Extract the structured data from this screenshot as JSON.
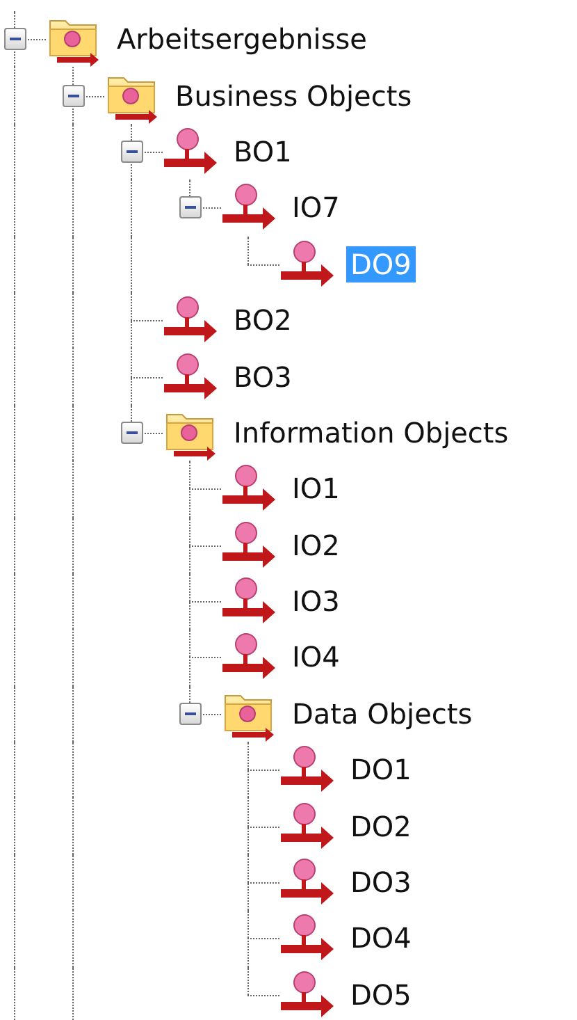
{
  "tree": {
    "items": [
      {
        "label": "Arbeitsergebnisse",
        "kind": "folder",
        "expanded": true,
        "selected": false,
        "more_above": true,
        "more_below": true,
        "children": [
          {
            "label": "Business Objects",
            "kind": "folder",
            "expanded": true,
            "selected": false,
            "more_below": true,
            "children": [
              {
                "label": "BO1",
                "kind": "object",
                "expanded": true,
                "selected": false,
                "children": [
                  {
                    "label": "IO7",
                    "kind": "object",
                    "expanded": true,
                    "selected": false,
                    "children": [
                      {
                        "label": "DO9",
                        "kind": "object",
                        "selected": true
                      }
                    ]
                  }
                ]
              },
              {
                "label": "BO2",
                "kind": "object",
                "selected": false
              },
              {
                "label": "BO3",
                "kind": "object",
                "selected": false
              },
              {
                "label": "Information Objects",
                "kind": "folder",
                "expanded": true,
                "selected": false,
                "children": [
                  {
                    "label": "IO1",
                    "kind": "object",
                    "selected": false
                  },
                  {
                    "label": "IO2",
                    "kind": "object",
                    "selected": false
                  },
                  {
                    "label": "IO3",
                    "kind": "object",
                    "selected": false
                  },
                  {
                    "label": "IO4",
                    "kind": "object",
                    "selected": false
                  },
                  {
                    "label": "Data Objects",
                    "kind": "folder",
                    "expanded": true,
                    "selected": false,
                    "children": [
                      {
                        "label": "DO1",
                        "kind": "object",
                        "selected": false
                      },
                      {
                        "label": "DO2",
                        "kind": "object",
                        "selected": false
                      },
                      {
                        "label": "DO3",
                        "kind": "object",
                        "selected": false
                      },
                      {
                        "label": "DO4",
                        "kind": "object",
                        "selected": false
                      },
                      {
                        "label": "DO5",
                        "kind": "object",
                        "selected": false
                      }
                    ]
                  }
                ]
              }
            ]
          }
        ]
      }
    ]
  }
}
